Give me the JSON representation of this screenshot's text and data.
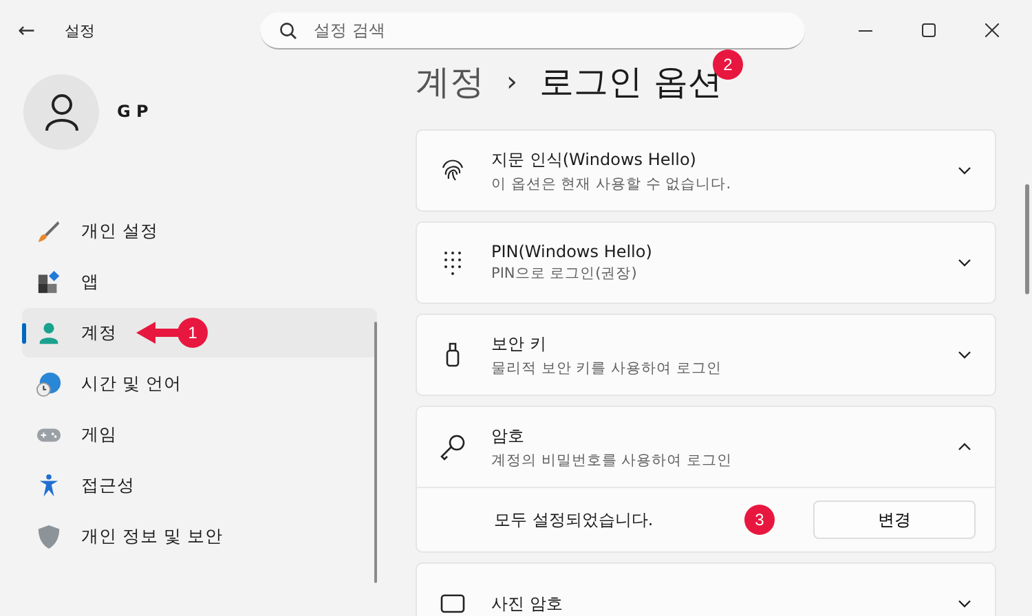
{
  "window": {
    "back": "←",
    "title": "설정"
  },
  "search": {
    "placeholder": "설정 검색"
  },
  "profile": {
    "name": "G P"
  },
  "sidebar": {
    "items": [
      {
        "label": "개인 설정",
        "kind": "brush",
        "selected": false
      },
      {
        "label": "앱",
        "kind": "apps",
        "selected": false
      },
      {
        "label": "계정",
        "kind": "person",
        "selected": true,
        "badge": "1"
      },
      {
        "label": "시간 및 언어",
        "kind": "globe",
        "selected": false
      },
      {
        "label": "게임",
        "kind": "gamepad",
        "selected": false
      },
      {
        "label": "접근성",
        "kind": "access",
        "selected": false
      },
      {
        "label": "개인 정보 및 보안",
        "kind": "shield",
        "selected": false
      }
    ]
  },
  "header": {
    "parent": "계정",
    "separator": "›",
    "title": "로그인 옵션",
    "badge": "2"
  },
  "options": [
    {
      "kind": "fingerprint",
      "title": "지문 인식(Windows Hello)",
      "subtitle": "이 옵션은 현재 사용할 수 없습니다.",
      "expanded": false
    },
    {
      "kind": "keypad",
      "title": "PIN(Windows Hello)",
      "subtitle": "PIN으로 로그인(권장)",
      "expanded": false
    },
    {
      "kind": "usbkey",
      "title": "보안 키",
      "subtitle": "물리적 보안 키를 사용하여 로그인",
      "expanded": false
    },
    {
      "kind": "key",
      "title": "암호",
      "subtitle": "계정의 비밀번호를 사용하여 로그인",
      "expanded": true,
      "detail": "모두 설정되었습니다.",
      "button": "변경",
      "badge": "3"
    },
    {
      "kind": "picture",
      "title": "사진 암호",
      "expanded": false
    }
  ]
}
